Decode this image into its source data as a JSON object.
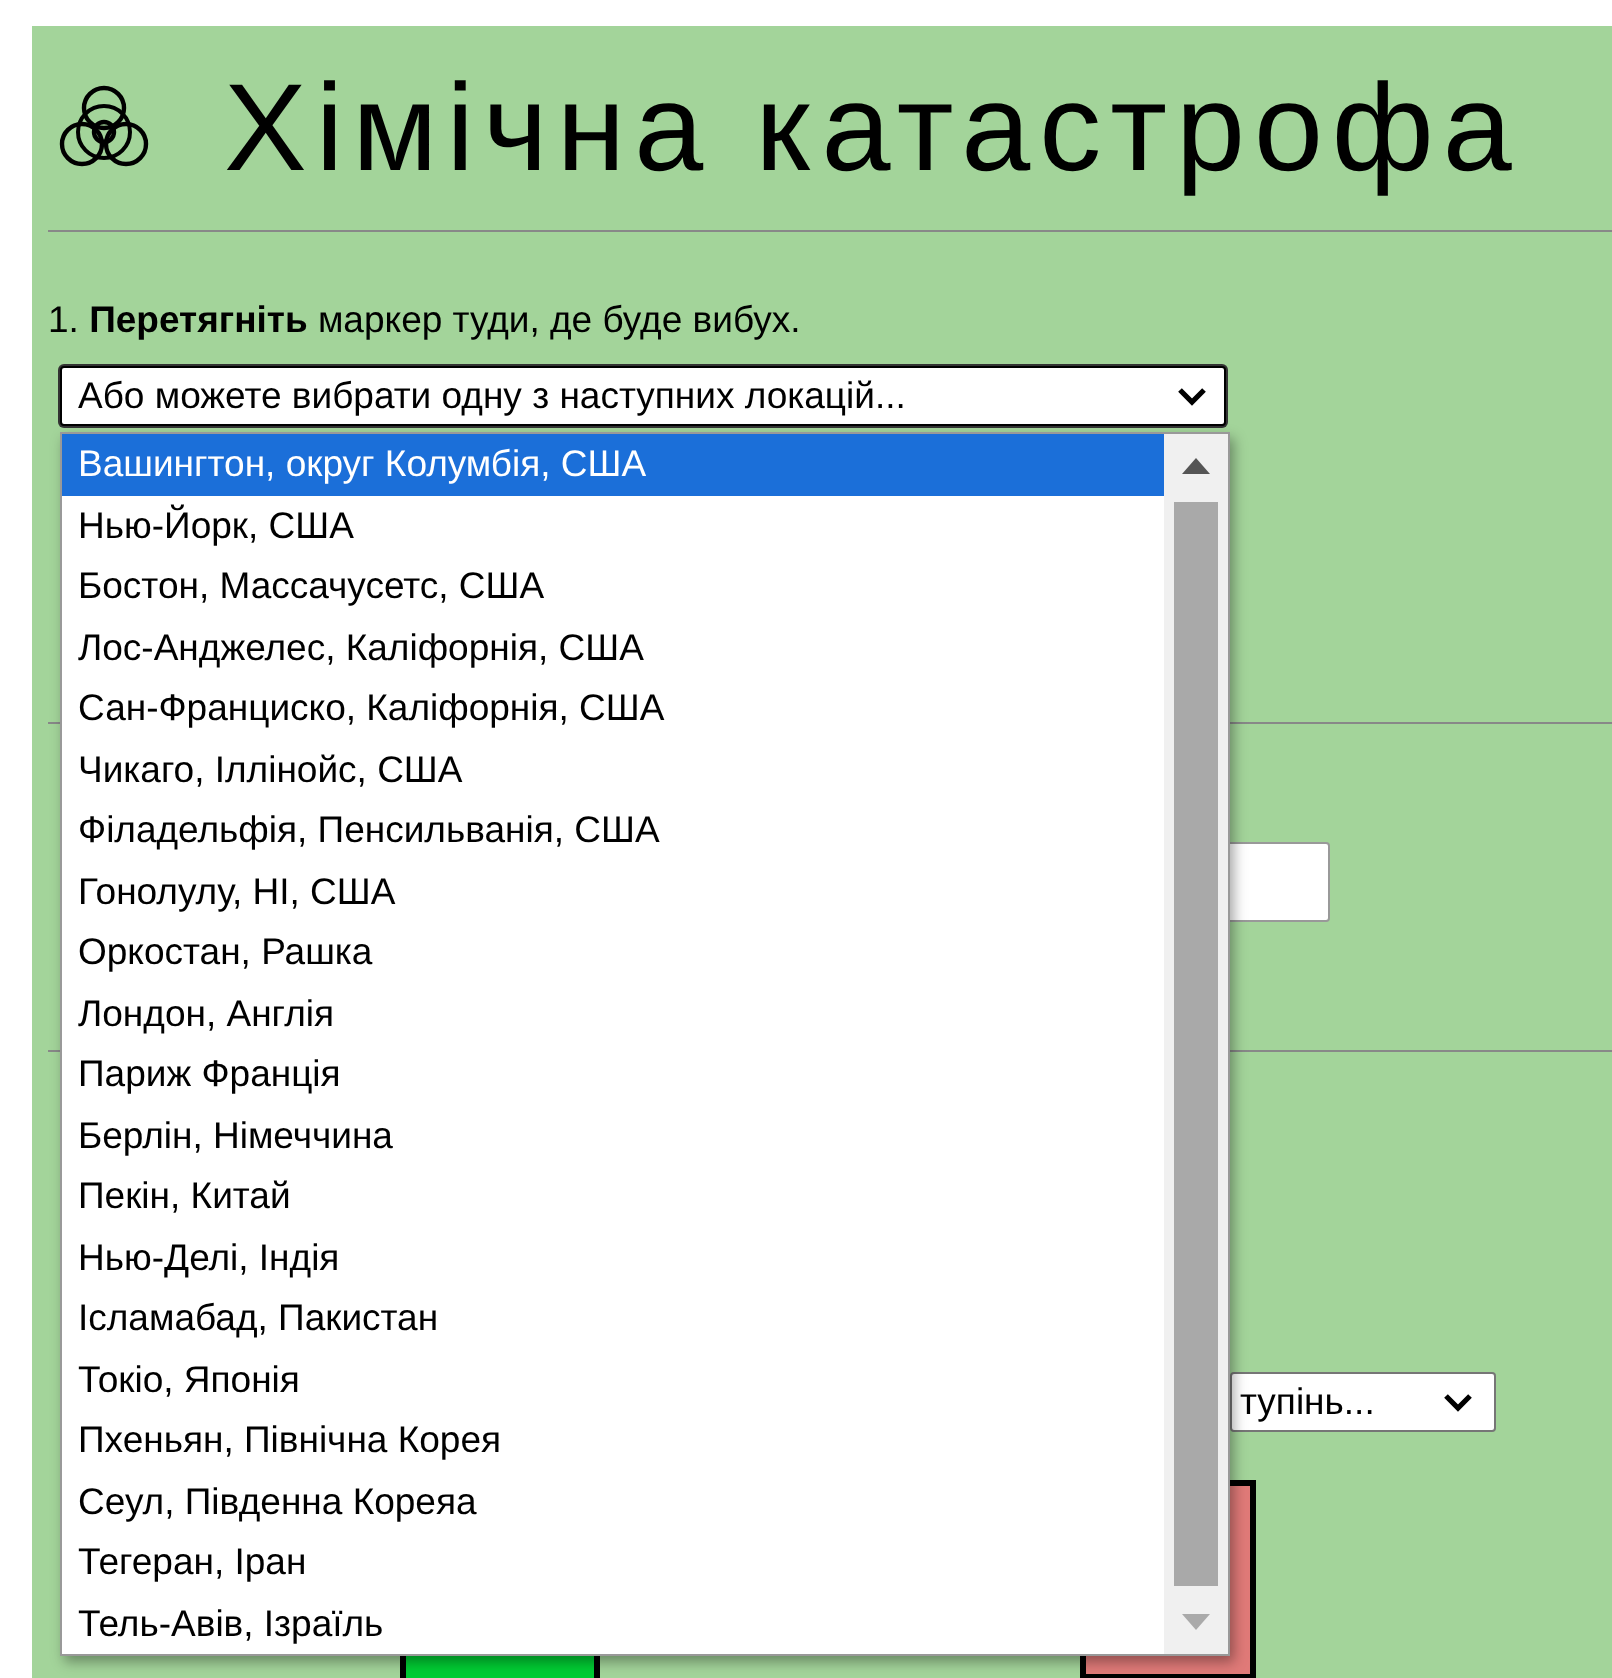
{
  "title": {
    "text": "Хімічна катастрофа"
  },
  "instruction": {
    "text": "1. **Перетягніть** маркер туди, де буде вибух."
  },
  "location_select": {
    "value": "Або можете вибрати одну з наступних локацій...",
    "expanded": true,
    "options": [
      {
        "label": "Вашингтон, округ Колумбія, США",
        "selected": true
      },
      {
        "label": "Нью-Йорк, США",
        "selected": false
      },
      {
        "label": "Бостон, Массачусетс, США",
        "selected": false
      },
      {
        "label": "Лос-Анджелес, Каліфорнія, США",
        "selected": false
      },
      {
        "label": "Сан-Франциско, Каліфорнія, США",
        "selected": false
      },
      {
        "label": "Чикаго, Іллінойс, США",
        "selected": false
      },
      {
        "label": "Філадельфія, Пенсильванія, США",
        "selected": false
      },
      {
        "label": "Гонолулу, HI, США",
        "selected": false
      },
      {
        "label": "Оркостан, Рашка",
        "selected": false
      },
      {
        "label": "Лондон, Англія",
        "selected": false
      },
      {
        "label": "Париж Франція",
        "selected": false
      },
      {
        "label": "Берлін, Німеччина",
        "selected": false
      },
      {
        "label": "Пекін, Китай",
        "selected": false
      },
      {
        "label": "Нью-Делі, Індія",
        "selected": false
      },
      {
        "label": "Ісламабад, Пакистан",
        "selected": false
      },
      {
        "label": "Токіо, Японія",
        "selected": false
      },
      {
        "label": "Пхеньян, Північна Корея",
        "selected": false
      },
      {
        "label": "Сеул, Південна Кореяа",
        "selected": false
      },
      {
        "label": "Тегеран, Іран",
        "selected": false
      },
      {
        "label": "Тель-Авів, Ізраїль",
        "selected": false
      }
    ]
  },
  "degree_select": {
    "value": "тупінь..."
  }
}
